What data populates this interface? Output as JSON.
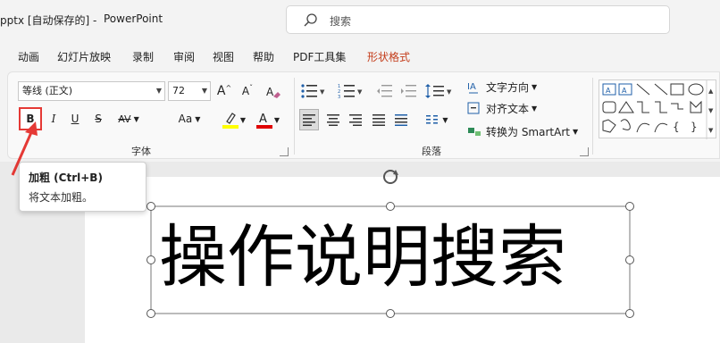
{
  "titlebar": {
    "doc_title": "pptx [自动保存的]  -",
    "app_name": "PowerPoint",
    "search_placeholder": "搜索"
  },
  "tabs": [
    {
      "label": "动画"
    },
    {
      "label": "幻灯片放映"
    },
    {
      "label": "录制"
    },
    {
      "label": "审阅"
    },
    {
      "label": "视图"
    },
    {
      "label": "帮助"
    },
    {
      "label": "PDF工具集"
    },
    {
      "label": "形状格式",
      "active": true
    }
  ],
  "font_group": {
    "font_name": "等线 (正文)",
    "font_size": "72",
    "grow_label": "A",
    "shrink_label": "A",
    "bold": "B",
    "italic": "I",
    "underline": "U",
    "strike": "S",
    "spacing": "AV",
    "case": "Aa",
    "color_a": "A",
    "label": "字体"
  },
  "paragraph_group": {
    "text_direction": "文字方向",
    "align_text": "对齐文本",
    "smartart": "转换为 SmartArt",
    "label": "段落"
  },
  "tooltip": {
    "title": "加粗 (Ctrl+B)",
    "description": "将文本加粗。"
  },
  "slide": {
    "text": "操作说明搜索"
  },
  "colors": {
    "accent_tab": "#c43e1c",
    "highlight": "#e53935",
    "highlight_bar": "#ffff00",
    "font_color_bar": "#e00000"
  }
}
